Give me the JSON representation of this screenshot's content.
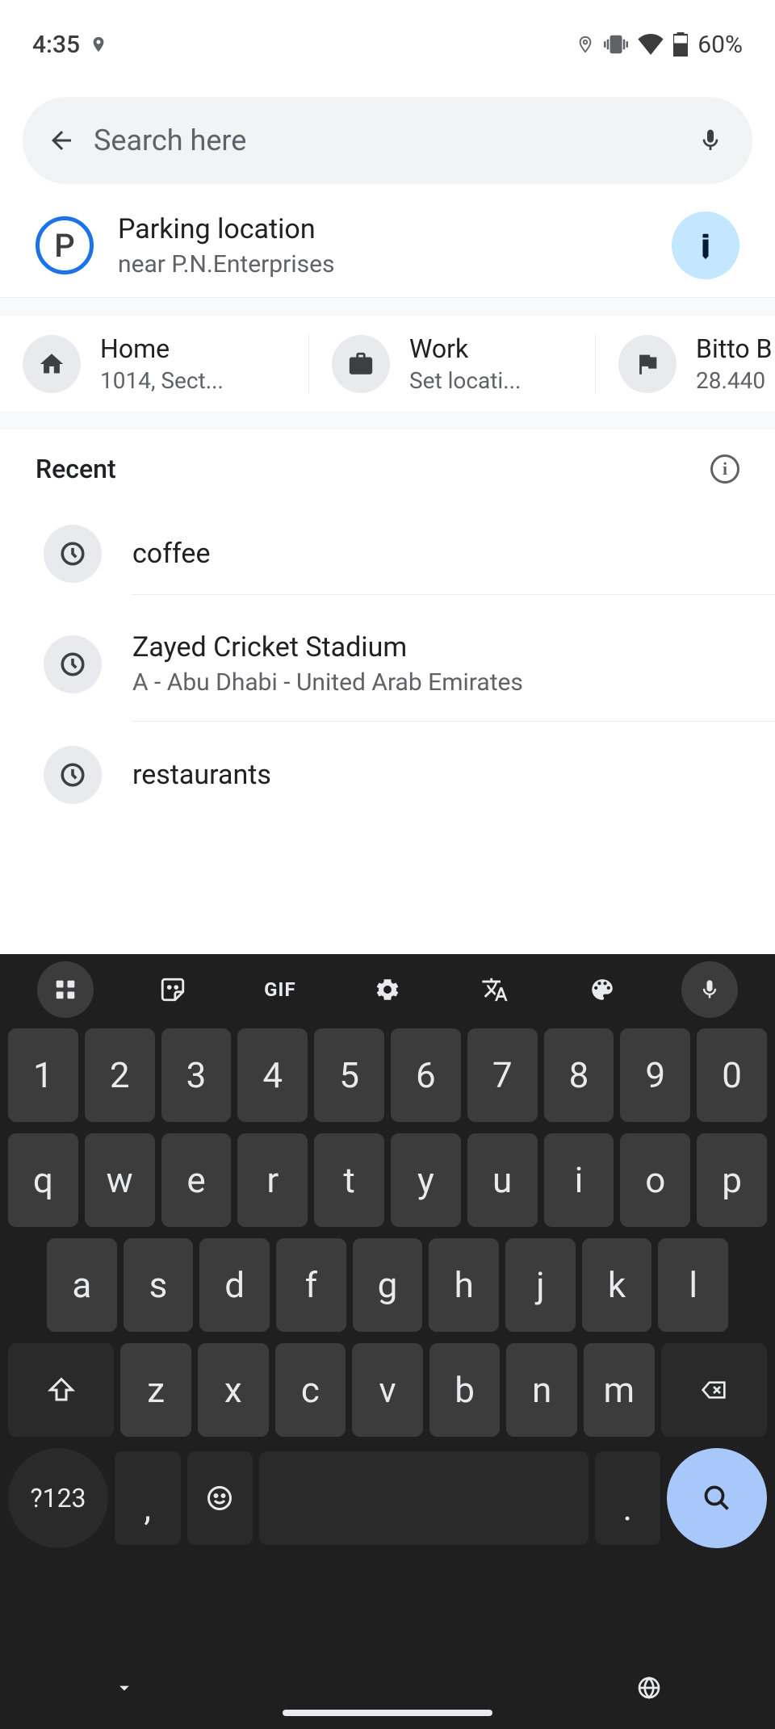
{
  "status": {
    "time": "4:35",
    "battery": "60%"
  },
  "search": {
    "placeholder": "Search here"
  },
  "parking": {
    "icon_letter": "P",
    "title": "Parking location",
    "subtitle": "near P.N.Enterprises"
  },
  "shortcuts": [
    {
      "title": "Home",
      "subtitle": "1014, Sect..."
    },
    {
      "title": "Work",
      "subtitle": "Set locati..."
    },
    {
      "title": "Bitto B",
      "subtitle": "28.440"
    }
  ],
  "recent": {
    "header": "Recent",
    "items": [
      {
        "label": "coffee",
        "sub": ""
      },
      {
        "label": "Zayed Cricket Stadium",
        "sub": "A - Abu Dhabi - United Arab Emirates"
      },
      {
        "label": "restaurants",
        "sub": ""
      }
    ]
  },
  "keyboard": {
    "row1": [
      "1",
      "2",
      "3",
      "4",
      "5",
      "6",
      "7",
      "8",
      "9",
      "0"
    ],
    "row2": [
      "q",
      "w",
      "e",
      "r",
      "t",
      "y",
      "u",
      "i",
      "o",
      "p"
    ],
    "row3": [
      "a",
      "s",
      "d",
      "f",
      "g",
      "h",
      "j",
      "k",
      "l"
    ],
    "row4": [
      "z",
      "x",
      "c",
      "v",
      "b",
      "n",
      "m"
    ],
    "mode": "?123",
    "comma": ",",
    "period": ".",
    "gif": "GIF"
  }
}
